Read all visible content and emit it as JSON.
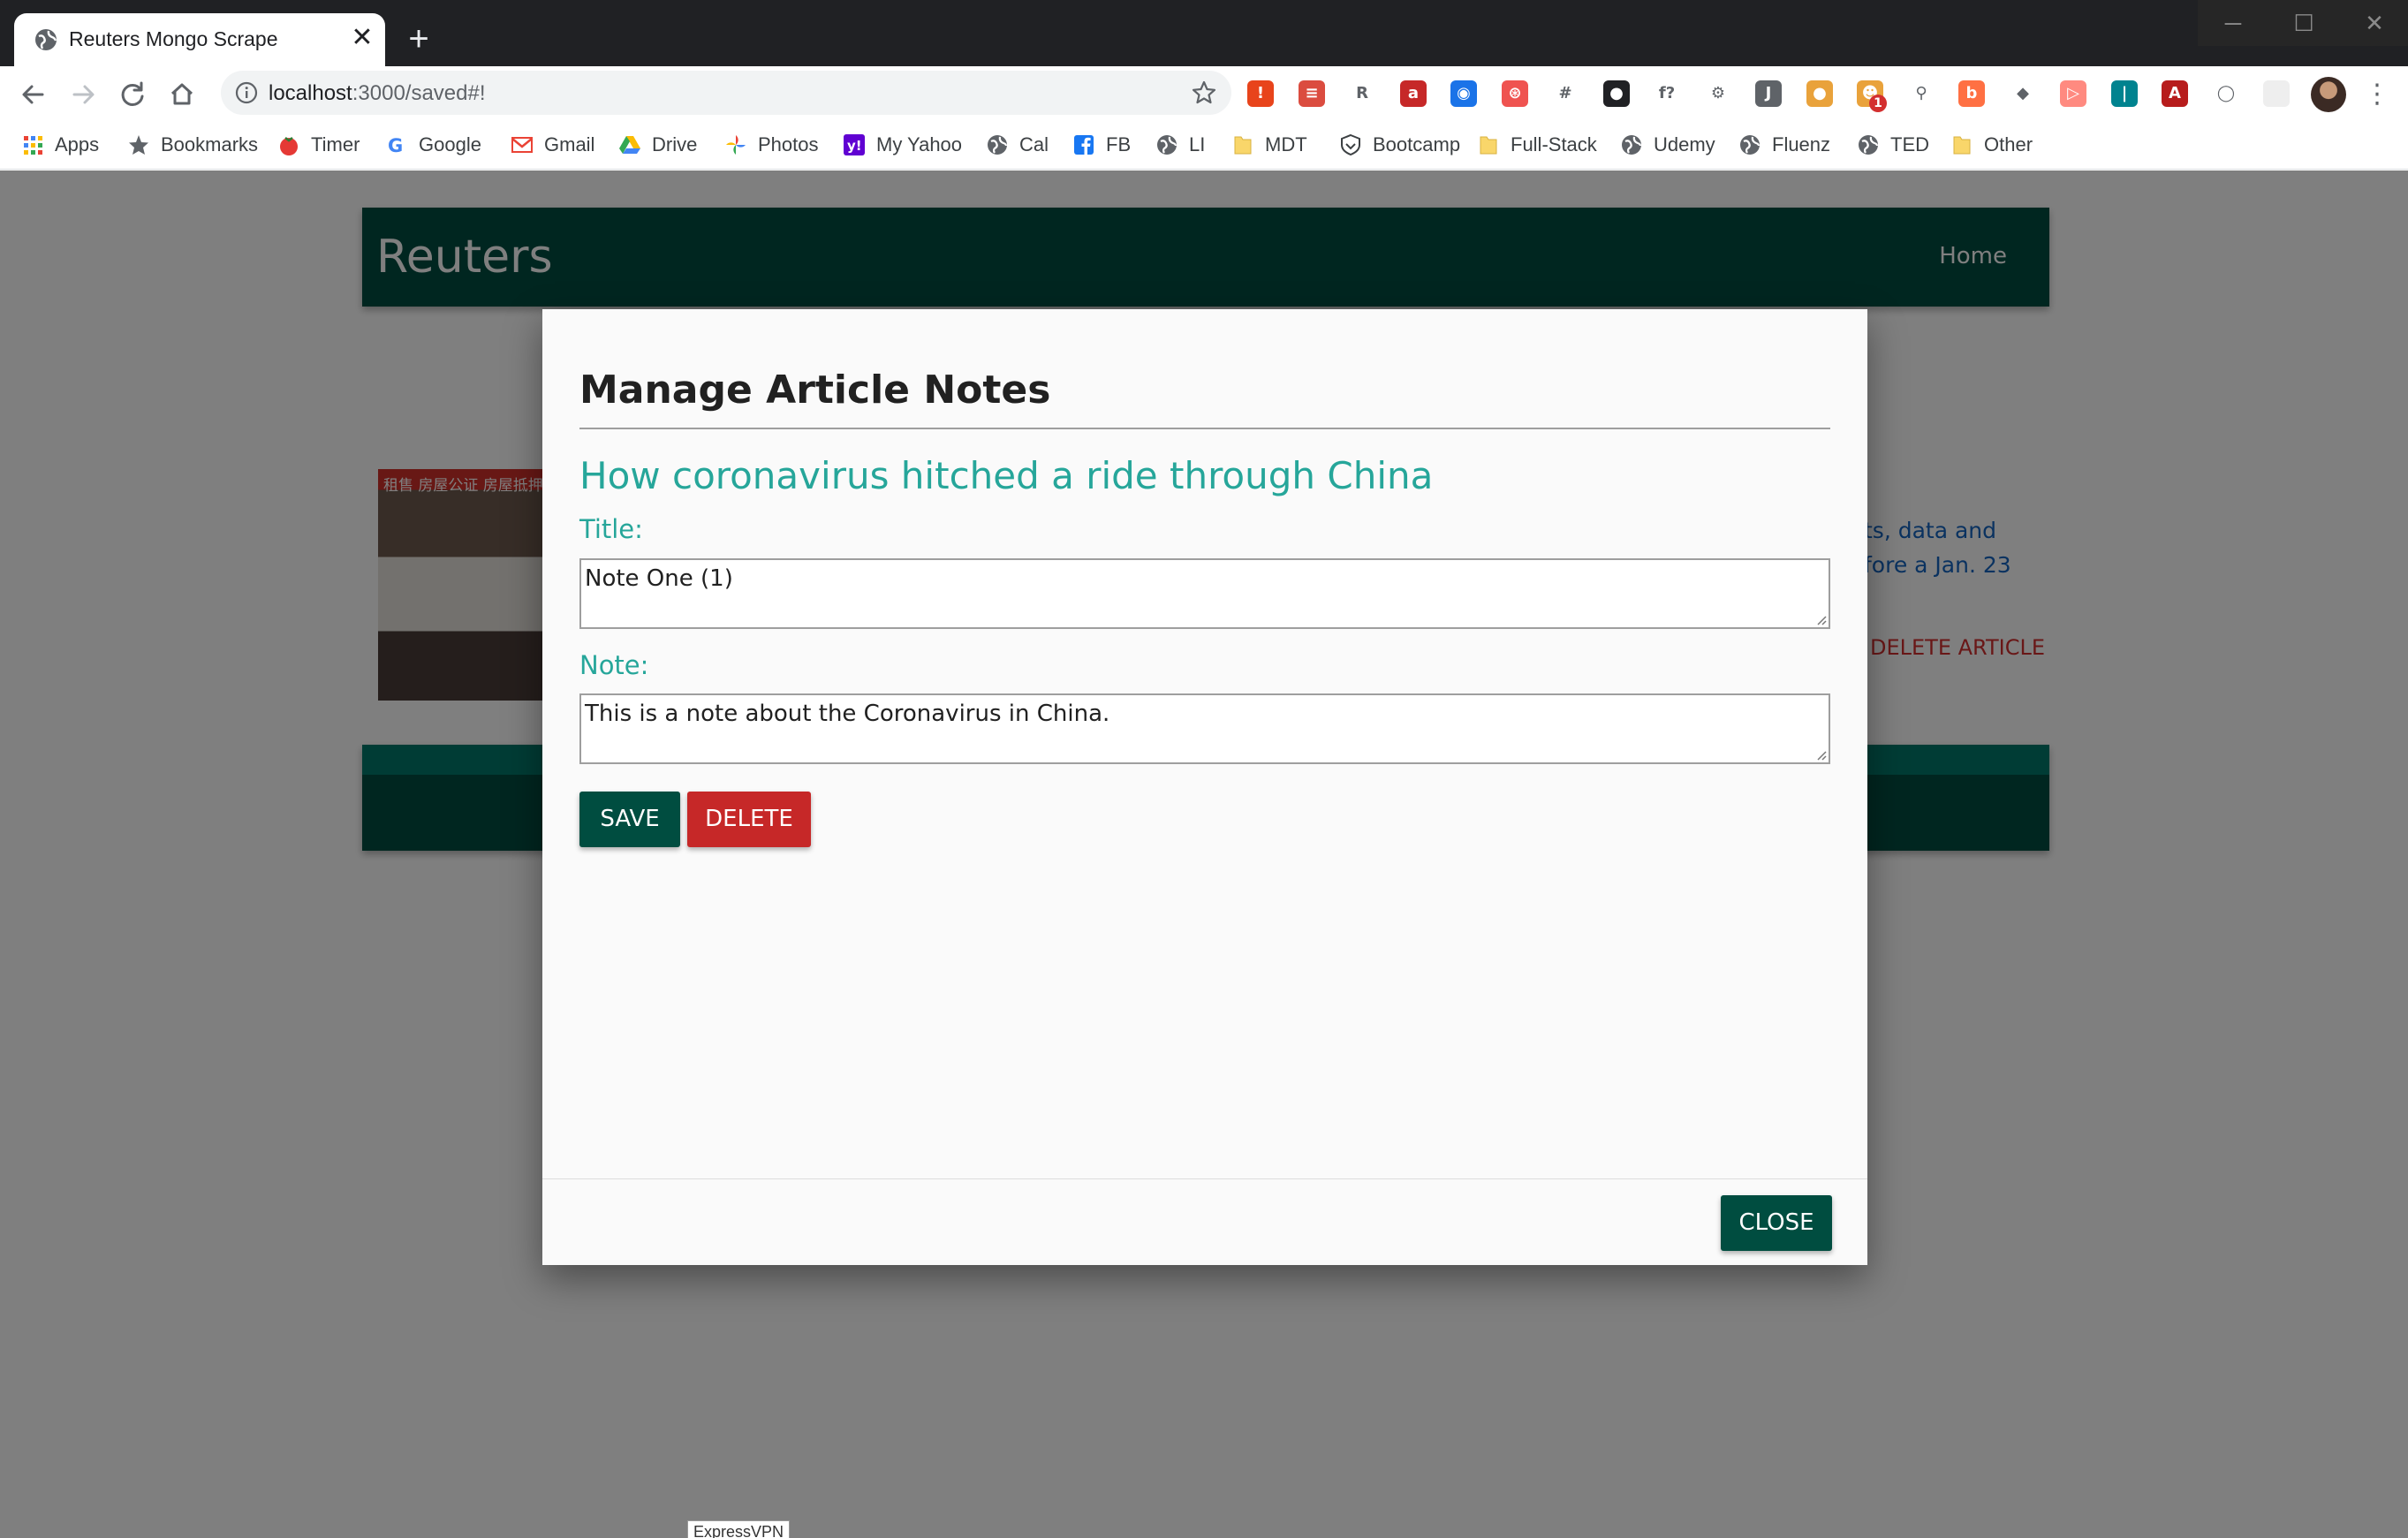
{
  "browser": {
    "tab_title": "Reuters Mongo Scrape",
    "close_tab_glyph": "✕",
    "new_tab_glyph": "+",
    "url_host": "localhost",
    "url_path": ":3000/saved#!",
    "window_controls": [
      "─",
      "☐",
      "✕"
    ],
    "menu_glyph": "⋮",
    "extension_badge": "1",
    "extensions": [
      {
        "icon": "stop-extension-icon",
        "glyph": "!",
        "color": "#e8441b"
      },
      {
        "icon": "todoist-icon",
        "glyph": "≡",
        "color": "#db4c3f"
      },
      {
        "icon": "r-extension-icon",
        "glyph": "R",
        "color": "#ffffff"
      },
      {
        "icon": "av-extension-icon",
        "glyph": "a",
        "color": "#c62828"
      },
      {
        "icon": "colorzilla-icon",
        "glyph": "◉",
        "color": "#1a73e8"
      },
      {
        "icon": "lastpass-icon",
        "glyph": "⊛",
        "color": "#ef5350"
      },
      {
        "icon": "hashtag-icon",
        "glyph": "#",
        "color": "#ffffff"
      },
      {
        "icon": "incognito-icon",
        "glyph": "●",
        "color": "#202124"
      },
      {
        "icon": "font-finder-icon",
        "glyph": "f?",
        "color": "#ffffff"
      },
      {
        "icon": "settings-extension-icon",
        "glyph": "⚙",
        "color": "#ffffff"
      },
      {
        "icon": "script-extension-icon",
        "glyph": "J",
        "color": "#5f6368"
      },
      {
        "icon": "cookie-icon",
        "glyph": "●",
        "color": "#e9a23b"
      },
      {
        "icon": "notification-extension-icon",
        "glyph": "☻",
        "color": "#e9a23b"
      },
      {
        "icon": "magnifier-extension-icon",
        "glyph": "⚲",
        "color": "#ffffff"
      },
      {
        "icon": "b-extension-icon",
        "glyph": "b",
        "color": "#ff7043"
      },
      {
        "icon": "dropbox-icon",
        "glyph": "◆",
        "color": "#ffffff"
      },
      {
        "icon": "cast-extension-icon",
        "glyph": "▷",
        "color": "#ff8a80"
      },
      {
        "icon": "bars-extension-icon",
        "glyph": "|",
        "color": "#00838f"
      },
      {
        "icon": "pdf-icon",
        "glyph": "A",
        "color": "#b71c1c"
      },
      {
        "icon": "code-extension-icon",
        "glyph": "◯",
        "color": "#ffffff"
      },
      {
        "icon": "blank-extension-icon",
        "glyph": "",
        "color": "#eeeeee"
      }
    ],
    "bookmarks": [
      {
        "label": "Apps",
        "icon": "apps-grid-icon",
        "color": "#4285f4"
      },
      {
        "label": "Bookmarks",
        "icon": "star-icon",
        "color": "#5f6368"
      },
      {
        "label": "Timer",
        "icon": "tomato-icon",
        "color": "#e53935"
      },
      {
        "label": "Google",
        "icon": "google-icon",
        "color": "#4285f4"
      },
      {
        "label": "Gmail",
        "icon": "gmail-icon",
        "color": "#ea4335"
      },
      {
        "label": "Drive",
        "icon": "drive-icon",
        "color": "#fbbc04"
      },
      {
        "label": "Photos",
        "icon": "photos-icon",
        "color": "#34a853"
      },
      {
        "label": "My Yahoo",
        "icon": "yahoo-icon",
        "color": "#6001d2"
      },
      {
        "label": "Cal",
        "icon": "globe-icon",
        "color": "#5f6368"
      },
      {
        "label": "FB",
        "icon": "facebook-icon",
        "color": "#1877f2"
      },
      {
        "label": "LI",
        "icon": "globe-icon",
        "color": "#5f6368"
      },
      {
        "label": "MDT",
        "icon": "folder-icon",
        "color": "#f9d66a"
      },
      {
        "label": "Bootcamp",
        "icon": "shield-icon",
        "color": "#3c4043"
      },
      {
        "label": "Full-Stack",
        "icon": "folder-icon",
        "color": "#f9d66a"
      },
      {
        "label": "Udemy",
        "icon": "globe-icon",
        "color": "#5f6368"
      },
      {
        "label": "Fluenz",
        "icon": "globe-icon",
        "color": "#5f6368"
      },
      {
        "label": "TED",
        "icon": "globe-icon",
        "color": "#5f6368"
      },
      {
        "label": "Other",
        "icon": "folder-icon",
        "color": "#f9d66a"
      }
    ]
  },
  "page": {
    "brand": "Reuters",
    "nav_home": "Home",
    "article_image_sign": "租售  房屋公证  房屋抵押",
    "article_snippet_lines": [
      "ts, data and",
      "fore a Jan. 23"
    ],
    "delete_article_label": "DELETE ARTICLE",
    "tooltip": "ExpressVPN",
    "colors": {
      "primary": "#004d40",
      "accent": "#26a69a",
      "danger": "#c62828",
      "link": "#1565c0"
    }
  },
  "modal": {
    "heading": "Manage Article Notes",
    "article_title": "How coronavirus hitched a ride through China",
    "title_label": "Title:",
    "title_value": "Note One (1)",
    "note_label": "Note:",
    "note_value": "This is a note about the Coronavirus in China.",
    "save_label": "SAVE",
    "delete_label": "DELETE",
    "close_label": "CLOSE"
  }
}
